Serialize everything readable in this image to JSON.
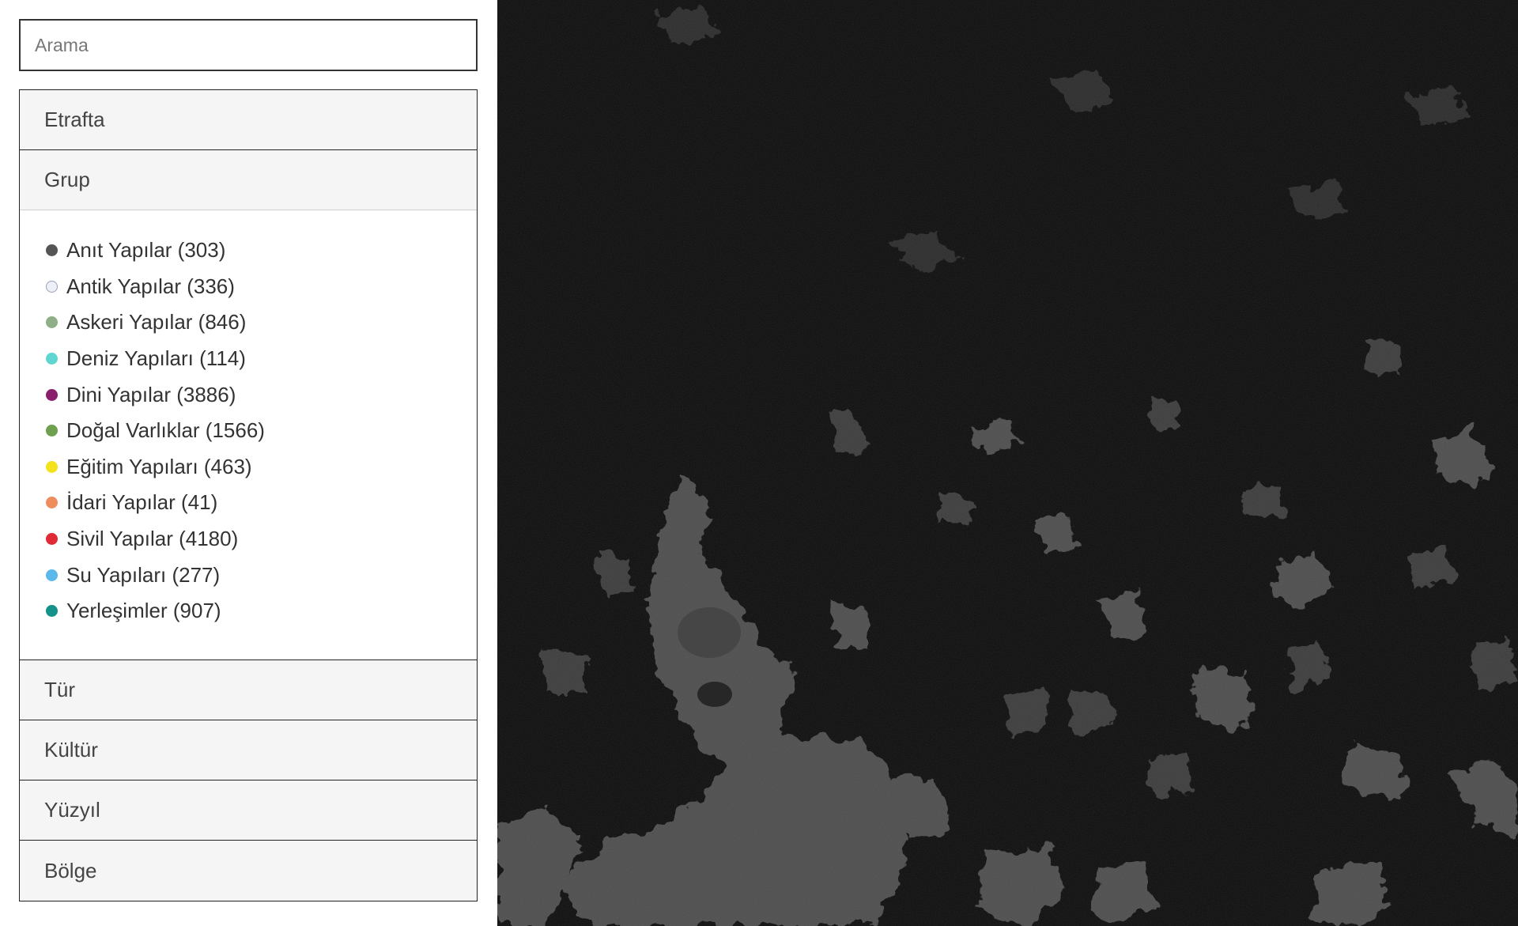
{
  "search": {
    "placeholder": "Arama",
    "value": ""
  },
  "filters": {
    "sections": [
      {
        "label": "Etrafta",
        "expanded": false
      },
      {
        "label": "Grup",
        "expanded": true
      },
      {
        "label": "Tür",
        "expanded": false
      },
      {
        "label": "Kültür",
        "expanded": false
      },
      {
        "label": "Yüzyıl",
        "expanded": false
      },
      {
        "label": "Bölge",
        "expanded": false
      }
    ],
    "groups": [
      {
        "label": "Anıt Yapılar (303)",
        "color": "#555555"
      },
      {
        "label": "Antik Yapılar (336)",
        "color": "#eef0f8"
      },
      {
        "label": "Askeri Yapılar (846)",
        "color": "#8fb087"
      },
      {
        "label": "Deniz Yapıları (114)",
        "color": "#5fd6cf"
      },
      {
        "label": "Dini Yapılar (3886)",
        "color": "#8a1f6e"
      },
      {
        "label": "Doğal Varlıklar (1566)",
        "color": "#6fa050"
      },
      {
        "label": "Eğitim Yapıları (463)",
        "color": "#f4e21c"
      },
      {
        "label": "İdari Yapılar (41)",
        "color": "#ee8e5c"
      },
      {
        "label": "Sivil Yapılar (4180)",
        "color": "#e02a35"
      },
      {
        "label": "Su Yapıları (277)",
        "color": "#5bb8ea"
      },
      {
        "label": "Yerleşimler (907)",
        "color": "#149188"
      }
    ]
  },
  "map": {
    "style": "dark satellite imagery",
    "background_color": "#0b0b0b",
    "land_color": "#5a5a5a"
  }
}
